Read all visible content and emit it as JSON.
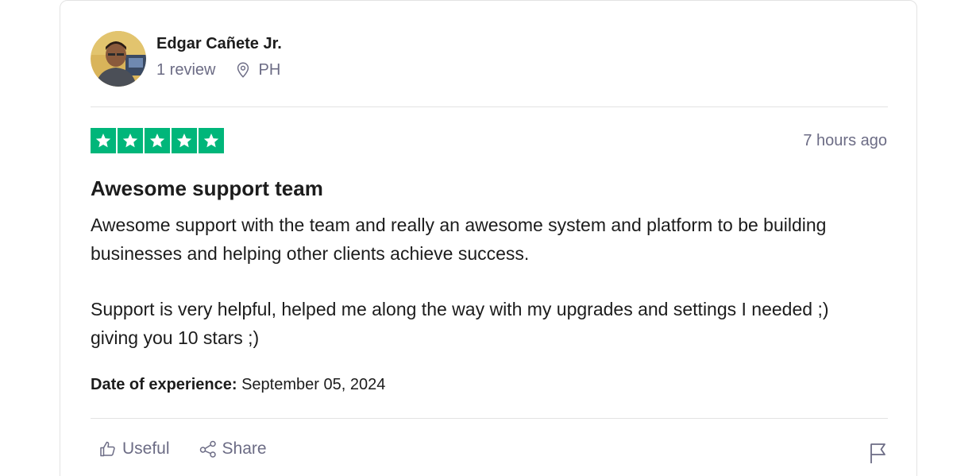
{
  "author": {
    "name": "Edgar Cañete Jr.",
    "review_count": "1 review",
    "location": "PH",
    "avatar_icon": "user-photo-avatar"
  },
  "review": {
    "rating": 5,
    "rating_max": 5,
    "star_color": "#00b67a",
    "time_ago": "7 hours ago",
    "title": "Awesome support team",
    "paragraphs": [
      "Awesome support with the team and really an awesome system and platform to be building businesses and helping other clients achieve success.",
      "Support is very helpful, helped me along the way with my upgrades and settings I needed ;) giving you 10 stars ;)"
    ],
    "date_label": "Date of experience:",
    "date_value": "September 05, 2024"
  },
  "actions": {
    "useful_label": "Useful",
    "useful_icon": "thumbs-up-icon",
    "share_label": "Share",
    "share_icon": "share-icon",
    "flag_icon": "flag-icon"
  }
}
